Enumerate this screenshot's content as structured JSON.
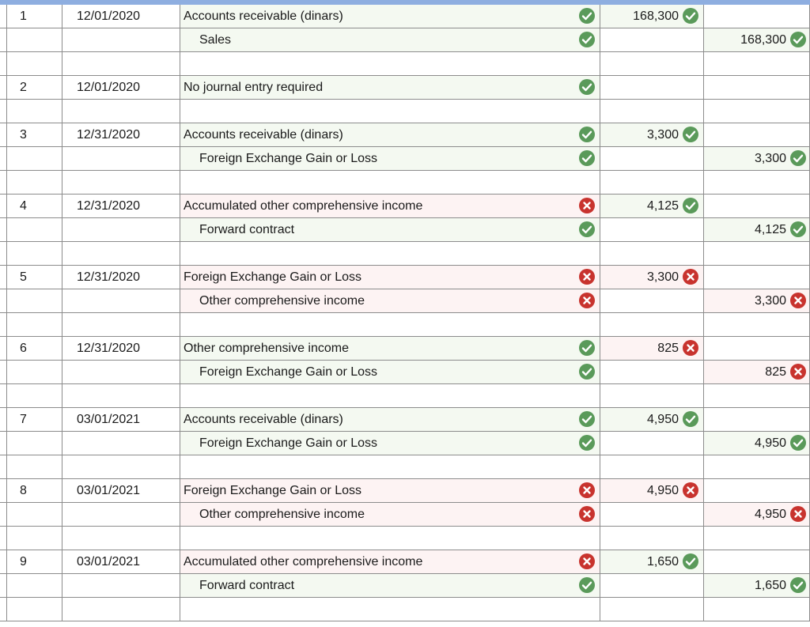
{
  "rows": [
    {
      "num": "1",
      "date": "12/01/2020",
      "account": "Accounts receivable (dinars)",
      "indent": false,
      "acct_status": "correct",
      "debit": "168,300",
      "debit_status": "correct",
      "credit": "",
      "credit_status": ""
    },
    {
      "num": "",
      "date": "",
      "account": "Sales",
      "indent": true,
      "acct_status": "correct",
      "debit": "",
      "debit_status": "",
      "credit": "168,300",
      "credit_status": "correct"
    },
    {
      "num": "",
      "date": "",
      "account": "",
      "indent": false,
      "acct_status": "",
      "debit": "",
      "debit_status": "",
      "credit": "",
      "credit_status": ""
    },
    {
      "num": "2",
      "date": "12/01/2020",
      "account": "No journal entry required",
      "indent": false,
      "acct_status": "correct",
      "debit": "",
      "debit_status": "",
      "credit": "",
      "credit_status": ""
    },
    {
      "num": "",
      "date": "",
      "account": "",
      "indent": false,
      "acct_status": "",
      "debit": "",
      "debit_status": "",
      "credit": "",
      "credit_status": ""
    },
    {
      "num": "3",
      "date": "12/31/2020",
      "account": "Accounts receivable (dinars)",
      "indent": false,
      "acct_status": "correct",
      "debit": "3,300",
      "debit_status": "correct",
      "credit": "",
      "credit_status": ""
    },
    {
      "num": "",
      "date": "",
      "account": "Foreign Exchange Gain or Loss",
      "indent": true,
      "acct_status": "correct",
      "debit": "",
      "debit_status": "",
      "credit": "3,300",
      "credit_status": "correct"
    },
    {
      "num": "",
      "date": "",
      "account": "",
      "indent": false,
      "acct_status": "",
      "debit": "",
      "debit_status": "",
      "credit": "",
      "credit_status": ""
    },
    {
      "num": "4",
      "date": "12/31/2020",
      "account": "Accumulated other comprehensive income",
      "indent": false,
      "acct_status": "incorrect",
      "debit": "4,125",
      "debit_status": "correct",
      "credit": "",
      "credit_status": ""
    },
    {
      "num": "",
      "date": "",
      "account": "Forward contract",
      "indent": true,
      "acct_status": "correct",
      "debit": "",
      "debit_status": "",
      "credit": "4,125",
      "credit_status": "correct"
    },
    {
      "num": "",
      "date": "",
      "account": "",
      "indent": false,
      "acct_status": "",
      "debit": "",
      "debit_status": "",
      "credit": "",
      "credit_status": ""
    },
    {
      "num": "5",
      "date": "12/31/2020",
      "account": "Foreign Exchange Gain or Loss",
      "indent": false,
      "acct_status": "incorrect",
      "debit": "3,300",
      "debit_status": "incorrect",
      "credit": "",
      "credit_status": ""
    },
    {
      "num": "",
      "date": "",
      "account": "Other comprehensive income",
      "indent": true,
      "acct_status": "incorrect",
      "debit": "",
      "debit_status": "",
      "credit": "3,300",
      "credit_status": "incorrect"
    },
    {
      "num": "",
      "date": "",
      "account": "",
      "indent": false,
      "acct_status": "",
      "debit": "",
      "debit_status": "",
      "credit": "",
      "credit_status": ""
    },
    {
      "num": "6",
      "date": "12/31/2020",
      "account": "Other comprehensive income",
      "indent": false,
      "acct_status": "correct",
      "debit": "825",
      "debit_status": "incorrect",
      "credit": "",
      "credit_status": ""
    },
    {
      "num": "",
      "date": "",
      "account": "Foreign Exchange Gain or Loss",
      "indent": true,
      "acct_status": "correct",
      "debit": "",
      "debit_status": "",
      "credit": "825",
      "credit_status": "incorrect"
    },
    {
      "num": "",
      "date": "",
      "account": "",
      "indent": false,
      "acct_status": "",
      "debit": "",
      "debit_status": "",
      "credit": "",
      "credit_status": ""
    },
    {
      "num": "7",
      "date": "03/01/2021",
      "account": "Accounts receivable (dinars)",
      "indent": false,
      "acct_status": "correct",
      "debit": "4,950",
      "debit_status": "correct",
      "credit": "",
      "credit_status": ""
    },
    {
      "num": "",
      "date": "",
      "account": "Foreign Exchange Gain or Loss",
      "indent": true,
      "acct_status": "correct",
      "debit": "",
      "debit_status": "",
      "credit": "4,950",
      "credit_status": "correct"
    },
    {
      "num": "",
      "date": "",
      "account": "",
      "indent": false,
      "acct_status": "",
      "debit": "",
      "debit_status": "",
      "credit": "",
      "credit_status": ""
    },
    {
      "num": "8",
      "date": "03/01/2021",
      "account": "Foreign Exchange Gain or Loss",
      "indent": false,
      "acct_status": "incorrect",
      "debit": "4,950",
      "debit_status": "incorrect",
      "credit": "",
      "credit_status": ""
    },
    {
      "num": "",
      "date": "",
      "account": "Other comprehensive income",
      "indent": true,
      "acct_status": "incorrect",
      "debit": "",
      "debit_status": "",
      "credit": "4,950",
      "credit_status": "incorrect"
    },
    {
      "num": "",
      "date": "",
      "account": "",
      "indent": false,
      "acct_status": "",
      "debit": "",
      "debit_status": "",
      "credit": "",
      "credit_status": ""
    },
    {
      "num": "9",
      "date": "03/01/2021",
      "account": "Accumulated other comprehensive income",
      "indent": false,
      "acct_status": "incorrect",
      "debit": "1,650",
      "debit_status": "correct",
      "credit": "",
      "credit_status": ""
    },
    {
      "num": "",
      "date": "",
      "account": "Forward contract",
      "indent": true,
      "acct_status": "correct",
      "debit": "",
      "debit_status": "",
      "credit": "1,650",
      "credit_status": "correct"
    },
    {
      "num": "",
      "date": "",
      "account": "",
      "indent": false,
      "acct_status": "",
      "debit": "",
      "debit_status": "",
      "credit": "",
      "credit_status": ""
    }
  ],
  "colors": {
    "correct_icon": "#5a9a5a",
    "incorrect_icon": "#c8332e",
    "correct_fill": "#f4f9f1",
    "incorrect_fill": "#fdf3f3",
    "header_bar": "#8eaee0"
  },
  "icons": {
    "correct": "check-circle-icon",
    "incorrect": "x-circle-icon"
  }
}
